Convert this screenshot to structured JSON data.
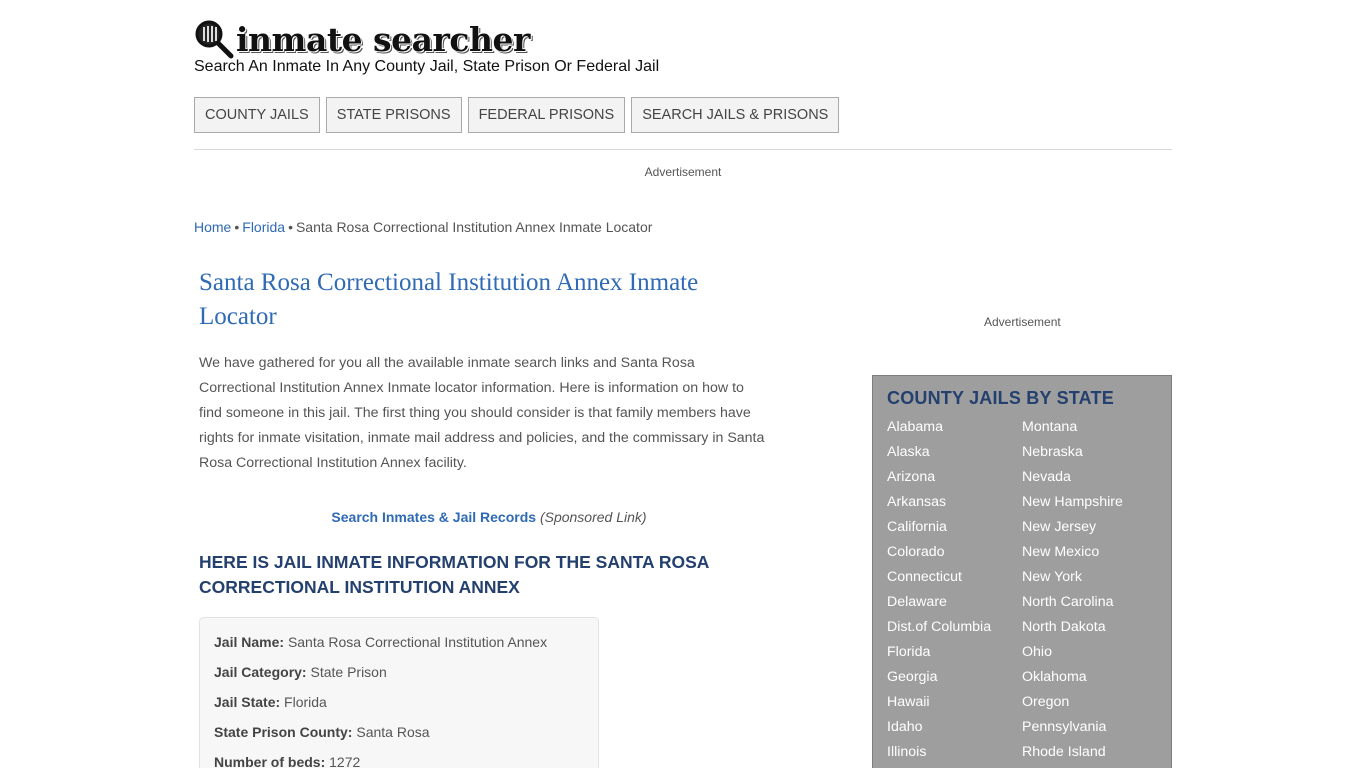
{
  "header": {
    "logo_text": "inmate searcher",
    "tagline": "Search An Inmate In Any County Jail, State Prison Or Federal Jail"
  },
  "nav": [
    {
      "label": "COUNTY JAILS"
    },
    {
      "label": "STATE PRISONS"
    },
    {
      "label": "FEDERAL PRISONS"
    },
    {
      "label": "SEARCH JAILS & PRISONS"
    }
  ],
  "ads": {
    "top": "Advertisement",
    "side": "Advertisement"
  },
  "breadcrumb": {
    "home": "Home",
    "state": "Florida",
    "current": "Santa Rosa Correctional Institution Annex Inmate Locator",
    "separator": "•"
  },
  "main": {
    "title": "Santa Rosa Correctional Institution Annex Inmate Locator",
    "intro": "We have gathered for you all the available inmate search links and Santa Rosa Correctional Institution Annex Inmate locator information. Here is information on how to find someone in this jail. The first thing you should consider is that family members have rights for inmate visitation, inmate mail address and policies, and the commissary in Santa Rosa Correctional Institution Annex facility.",
    "sponsor_link": "Search Inmates & Jail Records",
    "sponsor_note": "(Sponsored Link)",
    "section_heading": "HERE IS JAIL INMATE INFORMATION FOR THE SANTA ROSA CORRECTIONAL INSTITUTION ANNEX"
  },
  "info": [
    {
      "key": "Jail Name:",
      "value": "Santa Rosa Correctional Institution Annex"
    },
    {
      "key": "Jail Category:",
      "value": "State Prison"
    },
    {
      "key": "Jail State:",
      "value": "Florida"
    },
    {
      "key": "State Prison County:",
      "value": "Santa Rosa"
    },
    {
      "key": "Number of beds:",
      "value": "1272"
    }
  ],
  "sidebar": {
    "title": "COUNTY JAILS BY STATE",
    "states_left": [
      "Alabama",
      "Alaska",
      "Arizona",
      "Arkansas",
      "California",
      "Colorado",
      "Connecticut",
      "Delaware",
      "Dist.of Columbia",
      "Florida",
      "Georgia",
      "Hawaii",
      "Idaho",
      "Illinois"
    ],
    "states_right": [
      "Montana",
      "Nebraska",
      "Nevada",
      "New Hampshire",
      "New Jersey",
      "New Mexico",
      "New York",
      "North Carolina",
      "North Dakota",
      "Ohio",
      "Oklahoma",
      "Oregon",
      "Pennsylvania",
      "Rhode Island"
    ]
  }
}
